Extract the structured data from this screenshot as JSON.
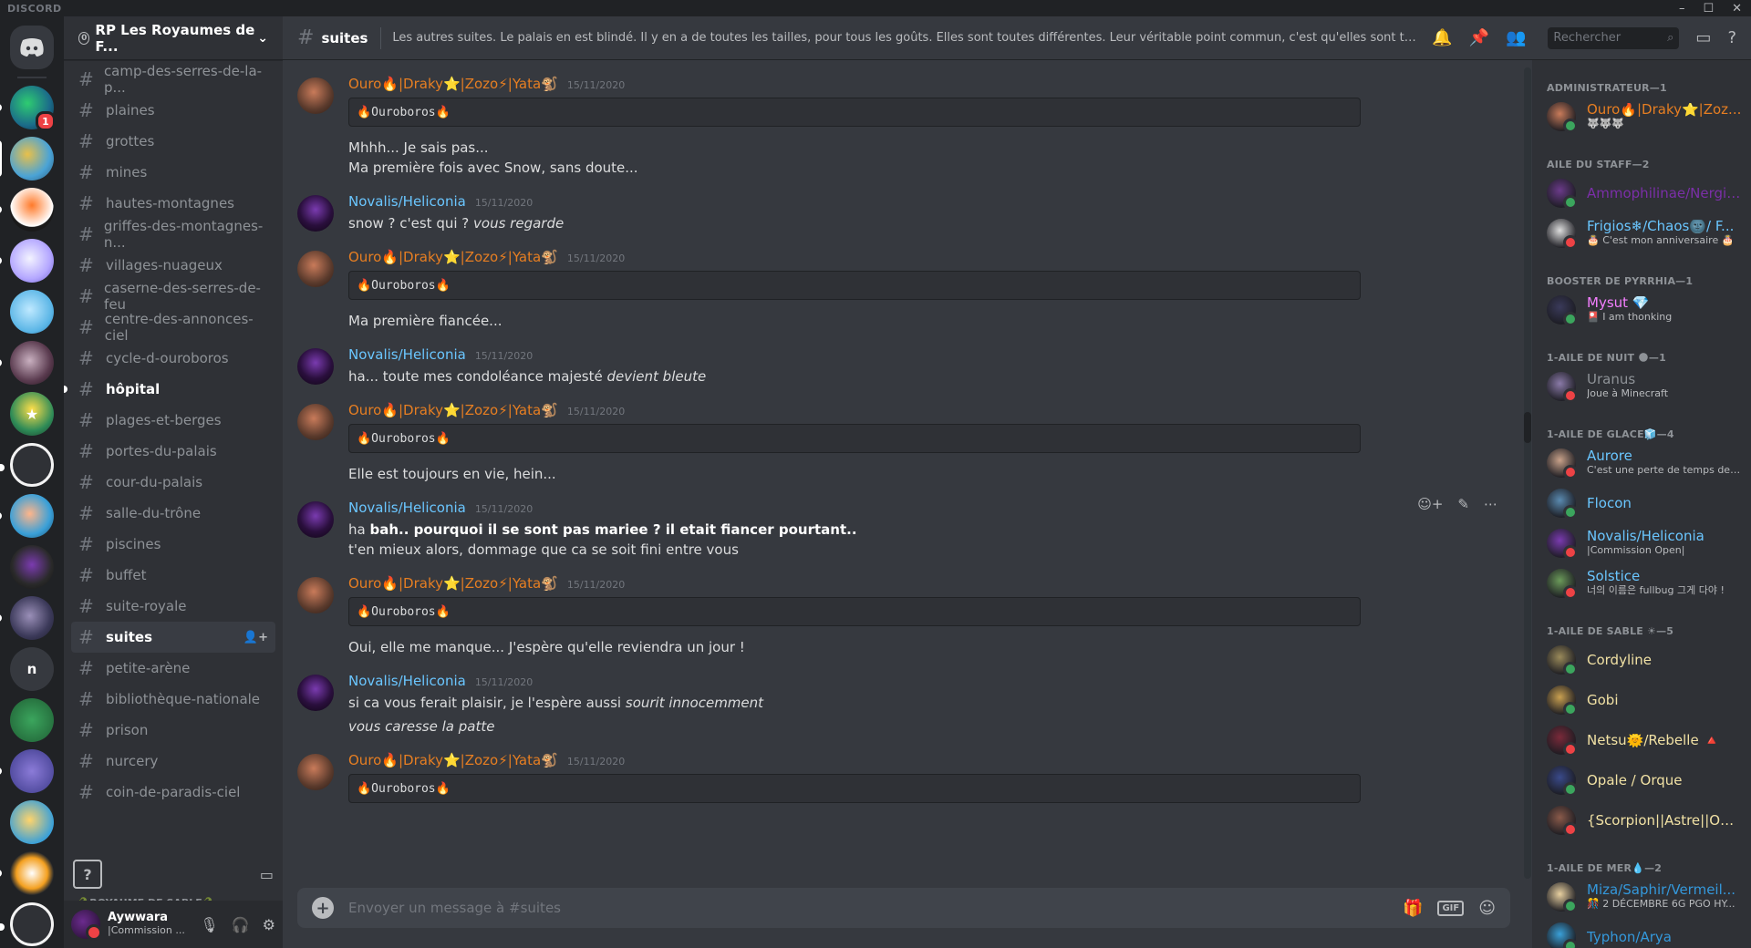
{
  "app": {
    "brand": "DISCORD"
  },
  "guild": {
    "name": "RP Les Royaumes de F...",
    "level": "0"
  },
  "channels": [
    {
      "name": "camp-des-serres-de-la-p..."
    },
    {
      "name": "plaines"
    },
    {
      "name": "grottes"
    },
    {
      "name": "mines"
    },
    {
      "name": "hautes-montagnes"
    },
    {
      "name": "griffes-des-montagnes-n..."
    },
    {
      "name": "villages-nuageux"
    },
    {
      "name": "caserne-des-serres-de-feu"
    },
    {
      "name": "centre-des-annonces-ciel"
    },
    {
      "name": "cycle-d-ouroboros"
    },
    {
      "name": "hôpital",
      "unread": true
    },
    {
      "name": "plages-et-berges"
    },
    {
      "name": "portes-du-palais"
    },
    {
      "name": "cour-du-palais"
    },
    {
      "name": "salle-du-trône"
    },
    {
      "name": "piscines"
    },
    {
      "name": "buffet"
    },
    {
      "name": "suite-royale"
    },
    {
      "name": "suites",
      "active": true
    },
    {
      "name": "petite-arène"
    },
    {
      "name": "bibliothèque-nationale"
    },
    {
      "name": "prison"
    },
    {
      "name": "nurcery"
    },
    {
      "name": "coin-de-paradis-ciel"
    }
  ],
  "category": "🐊ROYAUME DE SABLE🐊",
  "user": {
    "name": "Aywwara",
    "status": "|Commission ..."
  },
  "channel": {
    "name": "suites",
    "topic": "Les autres suites. Le palais en est blindé. Il y en a de toutes les tailles, pour tous les goûts. Elles sont toutes différentes. Leur véritable point commun, c'est qu'elles sont toutes très luxueuses. I...",
    "search_placeholder": "Rechercher"
  },
  "messages": [
    {
      "author": "Ouro🔥|Draky⭐|Zozo⚡|Yata🐒",
      "time": "15/11/2020",
      "color": "orange",
      "code": "🔥Ouroboros🔥"
    },
    {
      "author": "",
      "lines": [
        "Mhhh... Je sais pas...",
        "Ma première fois avec Snow, sans doute..."
      ]
    },
    {
      "author": "Novalis/Heliconia",
      "time": "15/11/2020",
      "color": "blue",
      "html": "snow ? c'est qui ? <i>vous regarde</i>"
    },
    {
      "author": "Ouro🔥|Draky⭐|Zozo⚡|Yata🐒",
      "time": "15/11/2020",
      "color": "orange",
      "code": "🔥Ouroboros🔥"
    },
    {
      "author": "",
      "lines": [
        "Ma première fiancée..."
      ]
    },
    {
      "author": "Novalis/Heliconia",
      "time": "15/11/2020",
      "color": "blue",
      "html": "ha... toute mes condoléance majesté <i>devient bleute</i>"
    },
    {
      "author": "Ouro🔥|Draky⭐|Zozo⚡|Yata🐒",
      "time": "15/11/2020",
      "color": "orange",
      "code": "🔥Ouroboros🔥"
    },
    {
      "author": "",
      "lines": [
        "Elle est toujours en vie, hein..."
      ]
    },
    {
      "author": "Novalis/Heliconia",
      "time": "15/11/2020",
      "color": "blue",
      "html": "ha <b>bah.. pourquoi il se sont pas mariee ? il etait fiancer pourtant..</b>",
      "lines2": [
        "t'en mieux alors, dommage que ca se soit fini entre vous"
      ],
      "tools": true
    },
    {
      "author": "Ouro🔥|Draky⭐|Zozo⚡|Yata🐒",
      "time": "15/11/2020",
      "color": "orange",
      "code": "🔥Ouroboros🔥"
    },
    {
      "author": "",
      "lines": [
        "Oui, elle me manque... J'espère qu'elle reviendra un jour !"
      ]
    },
    {
      "author": "Novalis/Heliconia",
      "time": "15/11/2020",
      "color": "blue",
      "html": "si ca vous ferait plaisir, je l'espère aussi <i>sourit innocemment</i>",
      "html2": "<i>vous caresse la patte</i>"
    },
    {
      "author": "Ouro🔥|Draky⭐|Zozo⚡|Yata🐒",
      "time": "15/11/2020",
      "color": "orange",
      "code": "🔥Ouroboros🔥"
    }
  ],
  "composer": {
    "placeholder": "Envoyer un message à #suites"
  },
  "members": [
    {
      "role": "ADMINISTRATEUR—1",
      "people": [
        {
          "name": "Ouro🔥|Draky⭐|Zoz...",
          "status": "🐺🐺🐺",
          "color": "#e67e22",
          "dot": "onl"
        }
      ]
    },
    {
      "role": "AILE DU STAFF—2",
      "people": [
        {
          "name": "Ammophilinae/Nergig...",
          "status": "",
          "color": "#7b2fa8",
          "dot": "onl"
        },
        {
          "name": "Frigios❄/Chaos🌚/ F...",
          "status": "🎂 C'est mon anniversaire 🎂",
          "color": "#6ac6ff",
          "dot": "dnd"
        }
      ]
    },
    {
      "role": "BOOSTER DE PYRRHIA—1",
      "people": [
        {
          "name": "Mysut 💎",
          "status": "🎴 I am thonking",
          "color": "#f47fff",
          "dot": "onl"
        }
      ]
    },
    {
      "role": "1-AILE DE NUIT 🌑—1",
      "people": [
        {
          "name": "Uranus",
          "status": "Joue à Minecraft",
          "color": "#8e9297",
          "dot": "dnd"
        }
      ]
    },
    {
      "role": "1-AILE DE GLACE🧊—4",
      "people": [
        {
          "name": "Aurore",
          "status": "C'est une perte de temps de ré...",
          "color": "#6ac6ff",
          "dot": "dnd"
        },
        {
          "name": "Flocon",
          "status": "",
          "color": "#6ac6ff",
          "dot": "onl"
        },
        {
          "name": "Novalis/Heliconia",
          "status": "|Commission Open|",
          "color": "#6ac6ff",
          "dot": "dnd"
        },
        {
          "name": "Solstice",
          "status": "너의 이름은 fullbug 그게 다야 !",
          "color": "#6ac6ff",
          "dot": "dnd"
        }
      ]
    },
    {
      "role": "1-AILE DE SABLE ☀—5",
      "people": [
        {
          "name": "Cordyline",
          "status": "",
          "color": "#f1e1a4",
          "dot": "onl"
        },
        {
          "name": "Gobi",
          "status": "",
          "color": "#f1e1a4",
          "dot": "onl"
        },
        {
          "name": "Netsu🌞/Rebelle 🔺",
          "status": "",
          "color": "#f1e1a4",
          "dot": "dnd"
        },
        {
          "name": "Opale / Orque",
          "status": "",
          "color": "#f1e1a4",
          "dot": "onl"
        },
        {
          "name": "{Scorpion||Astre||Obsi...",
          "status": "",
          "color": "#f1e1a4",
          "dot": "dnd"
        }
      ]
    },
    {
      "role": "1-AILE DE MER💧—2",
      "people": [
        {
          "name": "Miza/Saphir/Vermeil...",
          "status": "🎊 2 DÉCEMBRE 6G PGO HY...",
          "color": "#3498db",
          "dot": "onl"
        },
        {
          "name": "Typhon/Arya",
          "status": "",
          "color": "#3498db",
          "dot": "onl"
        }
      ]
    }
  ],
  "colors": {
    "accent": "#5865f2",
    "dnd": "#ed4245",
    "online": "#3ba55d"
  }
}
